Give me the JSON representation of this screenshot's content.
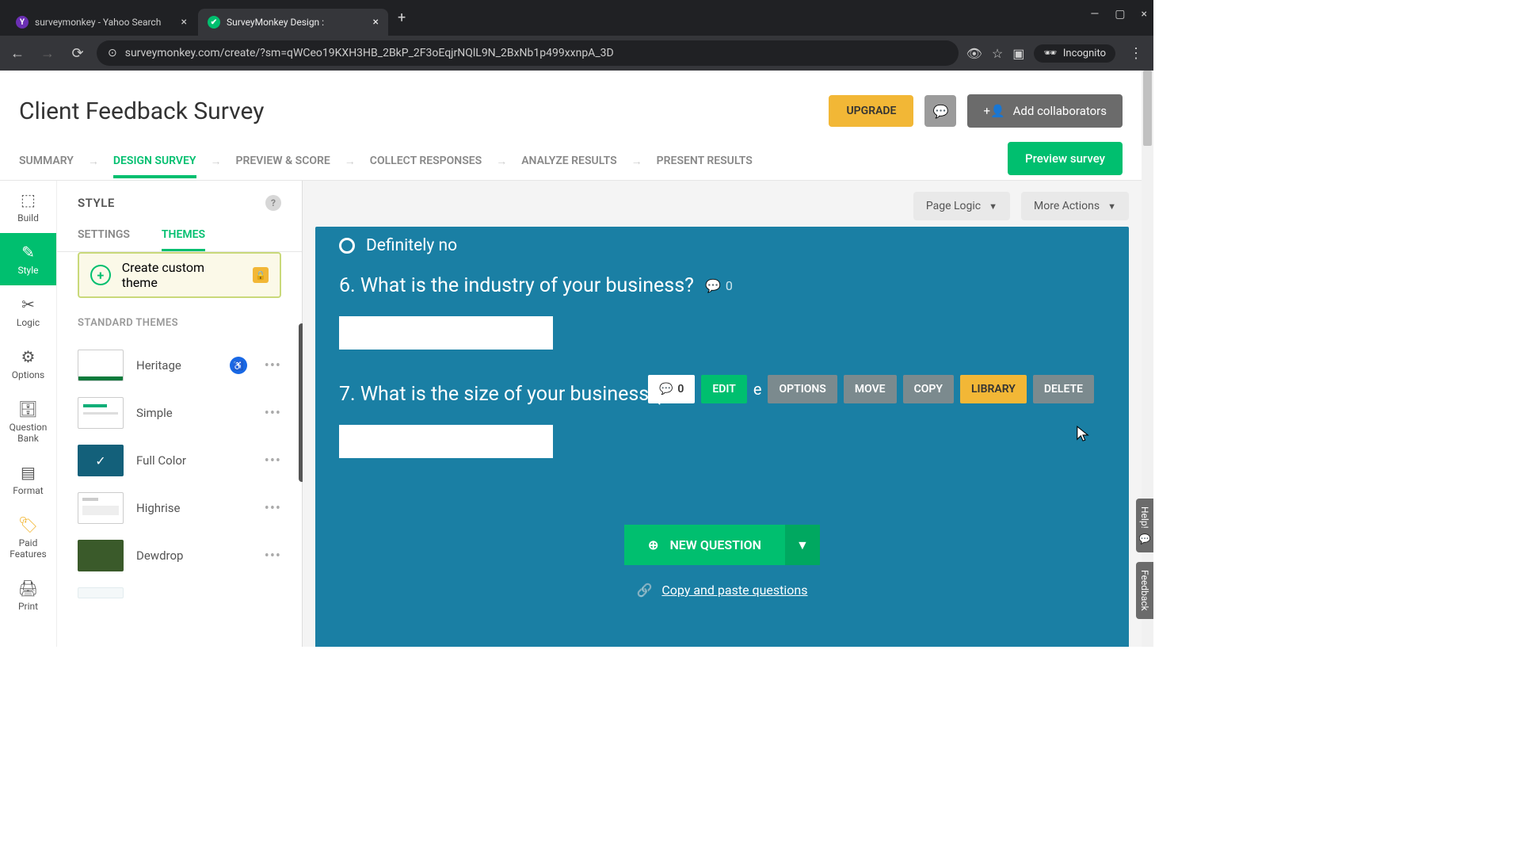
{
  "browser": {
    "tabs": [
      {
        "title": "surveymonkey - Yahoo Search ",
        "favicon_bg": "#6b2fb3",
        "favicon_txt": "Y"
      },
      {
        "title": "SurveyMonkey Design :",
        "favicon_bg": "#00bf6f",
        "favicon_txt": "✔"
      }
    ],
    "url": "surveymonkey.com/create/?sm=qWCeo19KXH3HB_2BkP_2F3oEqjrNQlL9N_2BxNb1p499xxnpA_3D",
    "incognito": "Incognito"
  },
  "header": {
    "title": "Client Feedback Survey",
    "upgrade": "UPGRADE",
    "collab": "Add collaborators"
  },
  "flow": {
    "tabs": [
      "SUMMARY",
      "DESIGN SURVEY",
      "PREVIEW & SCORE",
      "COLLECT RESPONSES",
      "ANALYZE RESULTS",
      "PRESENT RESULTS"
    ],
    "active": 1,
    "preview": "Preview survey"
  },
  "rail": [
    {
      "label": "Build"
    },
    {
      "label": "Style"
    },
    {
      "label": "Logic"
    },
    {
      "label": "Options"
    },
    {
      "label": "Question Bank"
    },
    {
      "label": "Format"
    },
    {
      "label": "Paid Features"
    },
    {
      "label": "Print"
    }
  ],
  "panel": {
    "title": "STYLE",
    "subtabs": {
      "settings": "SETTINGS",
      "themes": "THEMES"
    },
    "custom": "Create custom theme",
    "section": "STANDARD THEMES",
    "themes": [
      "Heritage",
      "Simple",
      "Full Color",
      "Highrise",
      "Dewdrop"
    ]
  },
  "canvas_tools": {
    "logic": "Page Logic",
    "more": "More Actions"
  },
  "survey": {
    "option_definitely_no": "Definitely no",
    "q6": {
      "title": "6. What is the industry of your business?",
      "comments": "0"
    },
    "q7": {
      "title": "7. What is the size of your business (n",
      "title_tail": "e",
      "comments": "0",
      "actions": {
        "edit": "EDIT",
        "options": "OPTIONS",
        "move": "MOVE",
        "copy": "COPY",
        "library": "LIBRARY",
        "delete": "DELETE"
      }
    },
    "new_question": "NEW QUESTION",
    "paste": "Copy and paste questions"
  },
  "float": {
    "help": "Help!",
    "feedback": "Feedback"
  }
}
